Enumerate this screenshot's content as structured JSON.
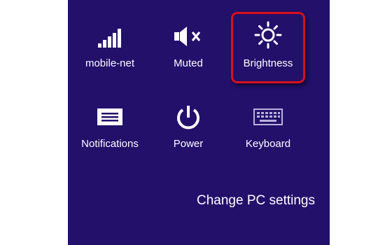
{
  "colors": {
    "panel_background": "#22106b",
    "text": "#ffffff",
    "highlight_border": "#d8101a"
  },
  "tiles": [
    {
      "label": "mobile-net",
      "icon": "signal-bars-icon"
    },
    {
      "label": "Muted",
      "icon": "speaker-muted-icon"
    },
    {
      "label": "Brightness",
      "icon": "brightness-sun-icon",
      "highlighted": true
    },
    {
      "label": "Notifications",
      "icon": "notifications-icon"
    },
    {
      "label": "Power",
      "icon": "power-icon"
    },
    {
      "label": "Keyboard",
      "icon": "keyboard-icon"
    }
  ],
  "footer": {
    "change_pc_settings": "Change PC settings"
  }
}
